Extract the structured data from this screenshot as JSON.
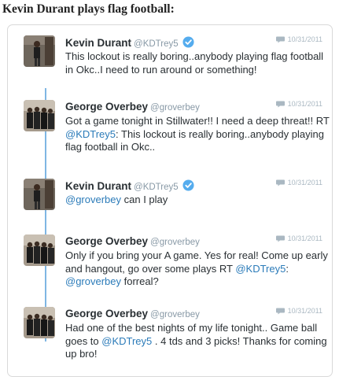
{
  "headline": "Kevin Durant plays flag football:",
  "tweets": [
    {
      "name": "Kevin Durant",
      "handle": "@KDTrey5",
      "verified": true,
      "date": "10/31/2011",
      "text_1": "This lockout is really boring..anybody playing flag football in Okc..I need to run around or something!"
    },
    {
      "name": "George Overbey",
      "handle": "@groverbey",
      "verified": false,
      "date": "10/31/2011",
      "text_1": "Got a game tonight in Stillwater!! I need a deep threat!! RT ",
      "mention_1": "@KDTrey5",
      "text_2": ": This lockout is really boring..anybody playing flag football in Okc.."
    },
    {
      "name": "Kevin Durant",
      "handle": "@KDTrey5",
      "verified": true,
      "date": "10/31/2011",
      "mention_1": "@groverbey",
      "text_1": " can I play"
    },
    {
      "name": "George Overbey",
      "handle": "@groverbey",
      "verified": false,
      "date": "10/31/2011",
      "text_1": "Only if you bring your A game. Yes for real! Come up early and hangout, go over some plays RT ",
      "mention_1": "@KDTrey5",
      "text_2": ": ",
      "mention_2": "@groverbey",
      "text_3": " forreal?"
    },
    {
      "name": "George Overbey",
      "handle": "@groverbey",
      "verified": false,
      "date": "10/31/2011",
      "text_1": "Had one of the best nights of my life tonight.. Game ball goes to ",
      "mention_1": "@KDTrey5",
      "text_2": " . 4 tds and 3 picks! Thanks for coming up bro!"
    }
  ],
  "colors": {
    "mention": "#2b7bb9",
    "verified": "#55acee",
    "thread_line": "#7fb6e3"
  }
}
